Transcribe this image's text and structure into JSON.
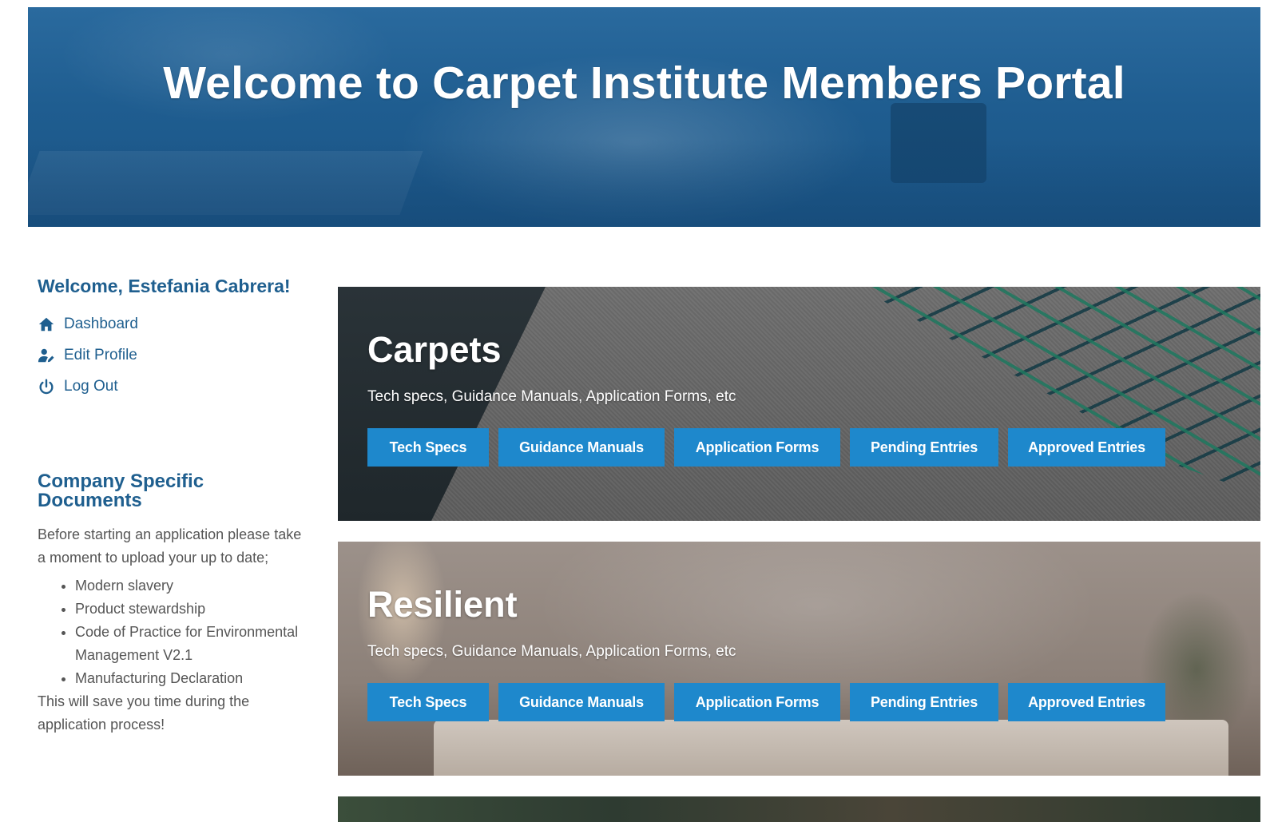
{
  "hero": {
    "title": "Welcome to Carpet Institute Members Portal"
  },
  "sidebar": {
    "welcome": "Welcome, Estefania Cabrera!",
    "nav": [
      {
        "label": "Dashboard",
        "icon": "home-icon"
      },
      {
        "label": "Edit Profile",
        "icon": "user-edit-icon"
      },
      {
        "label": "Log Out",
        "icon": "power-icon"
      }
    ],
    "docs": {
      "title": "Company Specific Documents",
      "intro": "Before starting an application please take a moment to upload your up to date;",
      "items": [
        "Modern slavery",
        "Product stewardship",
        "Code of Practice for Environmental Management V2.1",
        "Manufacturing Declaration"
      ],
      "outro": "This will save you time during the application process!"
    }
  },
  "categories": [
    {
      "title": "Carpets",
      "subtitle": "Tech specs, Guidance Manuals, Application Forms, etc",
      "buttons": [
        "Tech Specs",
        "Guidance Manuals",
        "Application Forms",
        "Pending Entries",
        "Approved Entries"
      ]
    },
    {
      "title": "Resilient",
      "subtitle": "Tech specs, Guidance Manuals, Application Forms, etc",
      "buttons": [
        "Tech Specs",
        "Guidance Manuals",
        "Application Forms",
        "Pending Entries",
        "Approved Entries"
      ]
    }
  ],
  "colors": {
    "brand_blue": "#1f5f8f",
    "button_blue": "#1e88cc",
    "hero_blue": "#1e5b8c"
  }
}
